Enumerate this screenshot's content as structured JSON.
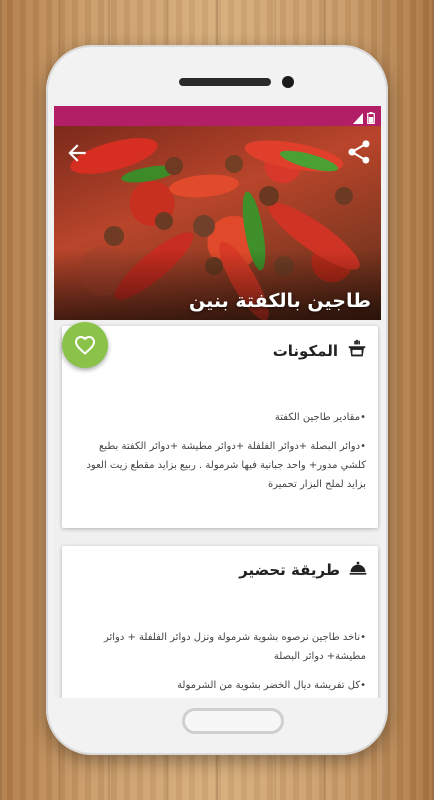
{
  "recipe": {
    "title": "طاجين بالكفتة بنين"
  },
  "ingredients": {
    "heading": "المكونات",
    "icon": "pot-icon",
    "items": [
      "•مقادير طاجين الكفتة",
      "•دوائر البصلة +دوائر الفلفلة +دوائر مطيشة +دوائر الكفتة بطبع كلشي مدور+ واحد جبانية فيها شرمولة . ربيع بزايد مقطع زيت العود بزايد لملح البزار تحميرة"
    ]
  },
  "preparation": {
    "heading": "طريقة تحضير",
    "icon": "cloche-icon",
    "steps": [
      "•ناخد طاجين نرصوه بشوية شرمولة ونزل دوائر الفلفلة + دوائر مطيشة+ دوائر البصلة",
      "•كل تفريشة ديال الخضر بشوية من الشرمولة"
    ]
  },
  "icons": {
    "back": "arrow-back-icon",
    "share": "share-icon",
    "favorite": "heart-icon",
    "signal": "signal-icon",
    "battery": "battery-icon"
  },
  "colors": {
    "status_bar": "#b21f67",
    "favorite_button": "#8bc34a",
    "card_background": "#ffffff",
    "screen_background": "#f0f0f0"
  }
}
